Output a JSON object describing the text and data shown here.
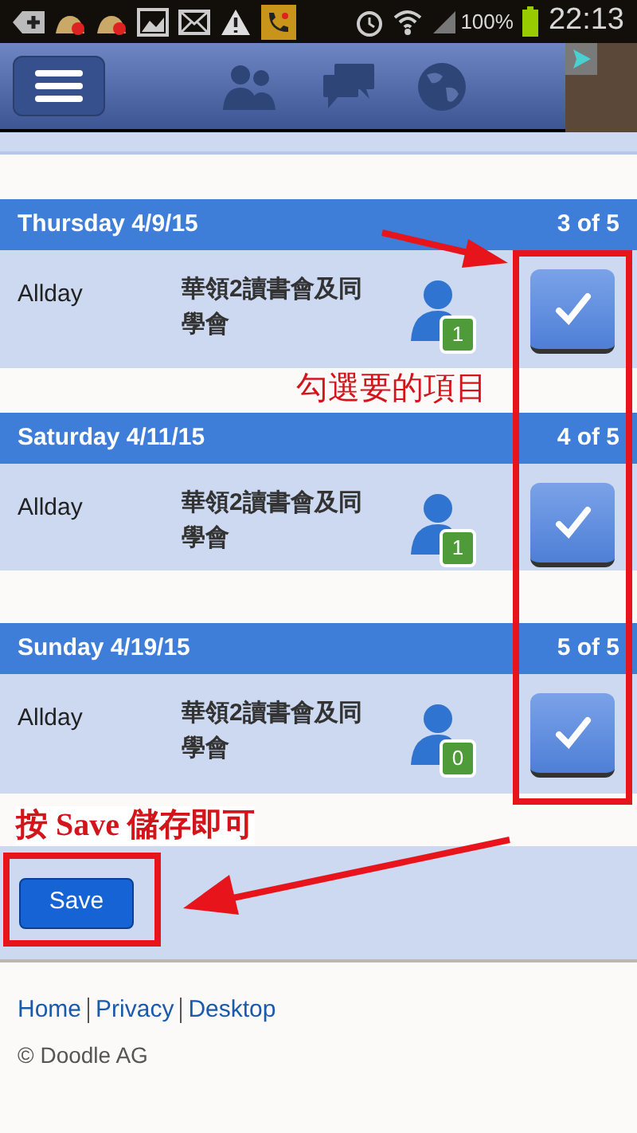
{
  "status_bar": {
    "battery": "100%",
    "time": "22:13"
  },
  "days": [
    {
      "date": "Thursday 4/9/15",
      "position": "3 of 5",
      "time": "Allday",
      "title": "華領2讀書會及同學會",
      "participants": "1",
      "checked": true
    },
    {
      "date": "Saturday 4/11/15",
      "position": "4 of 5",
      "time": "Allday",
      "title": "華領2讀書會及同學會",
      "participants": "1",
      "checked": true
    },
    {
      "date": "Sunday 4/19/15",
      "position": "5 of 5",
      "time": "Allday",
      "title": "華領2讀書會及同學會",
      "participants": "0",
      "checked": true
    }
  ],
  "save_button": "Save",
  "footer": {
    "links": [
      "Home",
      "Privacy",
      "Desktop"
    ],
    "copyright": "© Doodle AG"
  },
  "annotations": [
    "勾選要的項目",
    "按 Save 儲存即可"
  ]
}
